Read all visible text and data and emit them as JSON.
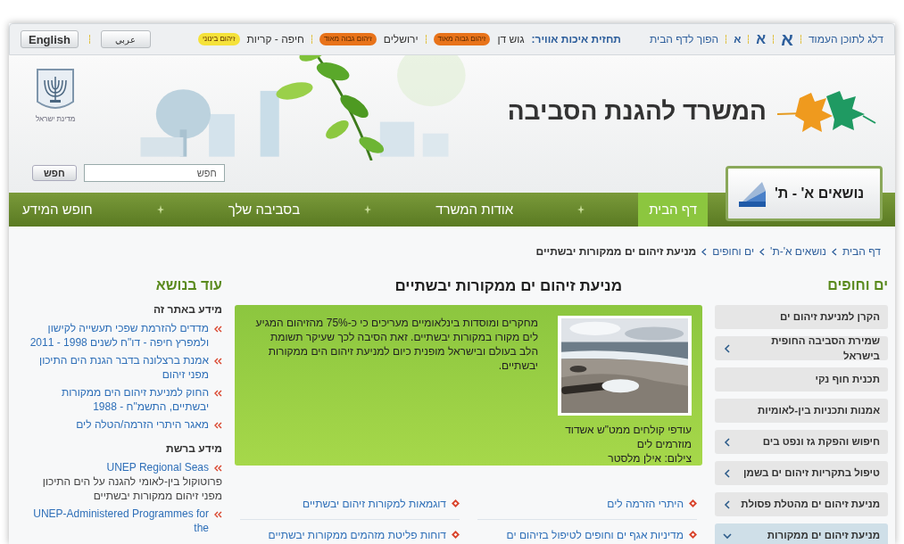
{
  "top_bar": {
    "skip_link": "דלג לתוכן העמוד",
    "font_sizes": [
      {
        "label": "א",
        "kind": "large"
      },
      {
        "label": "א",
        "kind": "medium"
      },
      {
        "label": "א",
        "kind": "small"
      }
    ],
    "home_link": "הפוך לדף הבית",
    "air_quality": {
      "label": "תחזית איכות אוויר:",
      "regions": [
        {
          "name": "גוש דן",
          "badge": "זיהום גבוה מאוד",
          "color": "#e8731a"
        },
        {
          "name": "ירושלים",
          "badge": "זיהום גבוה מאוד",
          "color": "#e8731a"
        },
        {
          "name": "חיפה - קריות",
          "badge": "זיהום בינוני",
          "color": "#f5e23a"
        }
      ]
    },
    "languages": [
      "عربي",
      "English"
    ]
  },
  "header": {
    "title": "המשרד להגנת הסביבה",
    "emblem_caption": "מדינת ישראל",
    "search": {
      "placeholder": "חפש",
      "button": "חפש"
    },
    "topics_button": "נושאים א' - ת'"
  },
  "nav": [
    {
      "label": "דף הבית",
      "selected": true
    },
    {
      "label": "אודות המשרד",
      "selected": false
    },
    {
      "label": "בסביבה שלך",
      "selected": false
    },
    {
      "label": "חופש המידע",
      "selected": false
    }
  ],
  "breadcrumb": {
    "links": [
      "דף הבית",
      "נושאים א'-ת'",
      "ים וחופים"
    ],
    "current": "מניעת זיהום ים ממקורות יבשתיים"
  },
  "sidebar": {
    "title": "ים וחופים",
    "items": [
      {
        "label": "הקרן למניעת זיהום ים",
        "has_children": false,
        "selected": false
      },
      {
        "label": "שמירת הסביבה החופית בישראל",
        "has_children": true,
        "selected": false
      },
      {
        "label": "תכנית חוף נקי",
        "has_children": false,
        "selected": false
      },
      {
        "label": "אמנות ותכניות בין-לאומיות",
        "has_children": false,
        "selected": false
      },
      {
        "label": "חיפוש והפקת גז ונפט בים",
        "has_children": true,
        "selected": false
      },
      {
        "label": "טיפול בתקריות זיהום ים בשמן",
        "has_children": true,
        "selected": false
      },
      {
        "label": "מניעת זיהום ים מהטלת פסולת",
        "has_children": true,
        "selected": false
      },
      {
        "label": "מניעת זיהום ים ממקורות",
        "has_children": true,
        "selected": true
      }
    ]
  },
  "main": {
    "title": "מניעת זיהום ים ממקורות יבשתיים",
    "caption": [
      "עודפי קולחים ממט\"ש אשדוד",
      "מוזרמים לים",
      "צילום: אילן מלסטר"
    ],
    "text": "מחקרים ומוסדות בינלאומיים מעריכים כי כ-75% מהזיהום המגיע לים מקורו במקורות יבשתיים. זאת הסיבה לכך שעיקר תשומת הלב בעולם ובישראל מופנית כיום למניעת זיהום הים ממקורות יבשתיים.",
    "links": [
      "היתרי הזרמה לים",
      "דוגמאות למקורות זיהום יבשתיים",
      "מדיניות אגף ים וחופים לטיפול בזיהום ים",
      "דוחות פליטת מזהמים ממקורות יבשתיים"
    ]
  },
  "related": {
    "title": "עוד בנושא",
    "sections": [
      {
        "heading": "מידע באתר זה",
        "items": [
          {
            "link": "מדדים להזרמת שפכי תעשייה לקישון ולמפרץ חיפה - דו\"ח לשנים 1998 - 2011"
          },
          {
            "link": "אמנת ברצלונה בדבר הגנת הים התיכון מפני זיהום"
          },
          {
            "link": "החוק למניעת זיהום הים ממקורות יבשתיים, התשמ\"ח - 1988"
          },
          {
            "link": "מאגר היתרי הזרמה/הטלה לים"
          }
        ]
      },
      {
        "heading": "מידע ברשת",
        "items": [
          {
            "link": "UNEP Regional Seas",
            "description": "פרוטוקול בין-לאומי להגנה על הים התיכון מפני זיהום ממקורות יבשתיים"
          },
          {
            "link": "UNEP-Administered Programmes for the"
          }
        ]
      }
    ]
  }
}
